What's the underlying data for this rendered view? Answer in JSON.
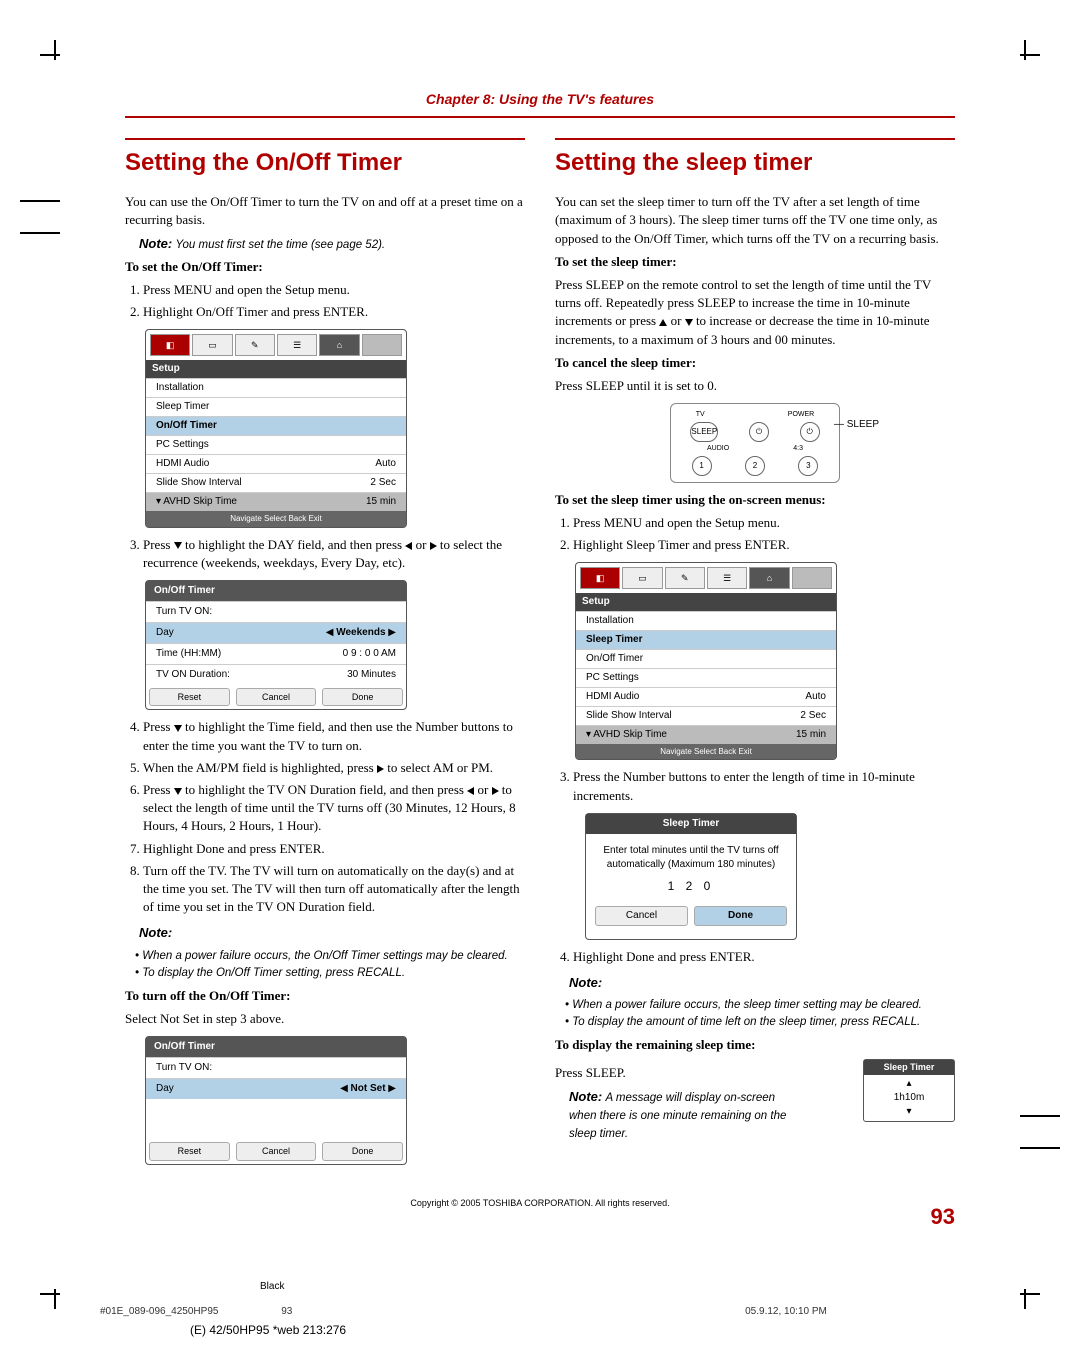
{
  "chapter": "Chapter 8: Using the TV's features",
  "left": {
    "title": "Setting the On/Off Timer",
    "intro": "You can use the On/Off Timer to turn the TV on and off at a preset time on a recurring basis.",
    "note1": "You must first set the time (see page 52).",
    "heading1": "To set the On/Off Timer:",
    "step1": "Press MENU and open the Setup menu.",
    "step2": "Highlight On/Off Timer and press ENTER.",
    "step3a": "Press ",
    "step3b": " to highlight the DAY field, and then press ",
    "step3c": " or ",
    "step3d": " to select the recurrence (weekends, weekdays, Every Day, etc).",
    "step4a": "Press ",
    "step4b": " to highlight the Time field, and then use the Number buttons to enter the time you want the TV to turn on.",
    "step5a": "When the AM/PM field is highlighted, press ",
    "step5b": " to select AM or PM.",
    "step6a": "Press ",
    "step6b": " to highlight the TV ON Duration field, and then press ",
    "step6c": " or ",
    "step6d": " to select the length of time until the TV turns off (30 Minutes, 12 Hours, 8 Hours, 4 Hours, 2 Hours, 1 Hour).",
    "step7": "Highlight Done and press ENTER.",
    "step8": "Turn off the TV. The TV will turn on automatically on the day(s) and at the time you set. The TV will then turn off automatically after the length of time you set in the TV ON Duration field.",
    "note2a": "When a power failure occurs, the On/Off Timer settings may be cleared.",
    "note2b": "To display the On/Off Timer setting, press RECALL.",
    "heading2": "To turn off the On/Off Timer:",
    "off_text": "Select Not Set in step 3 above."
  },
  "right": {
    "title": "Setting the sleep timer",
    "intro": "You can set the sleep timer to turn off the TV after a set length of time (maximum of 3 hours). The sleep timer turns off the TV one time only, as opposed to the On/Off Timer, which turns off the TV on a recurring basis.",
    "heading1": "To set the sleep timer:",
    "para1a": "Press SLEEP on the remote control to set the length of time until the TV turns off. Repeatedly press SLEEP to increase the time in 10-minute increments or press ",
    "para1b": " or ",
    "para1c": " to increase or decrease the time in 10-minute increments, to a maximum of 3 hours and 00 minutes.",
    "heading2": "To cancel the sleep timer:",
    "para2": "Press SLEEP until it is set to 0.",
    "heading3": "To set the sleep timer using the on-screen menus:",
    "step1": "Press MENU and open the Setup menu.",
    "step2": "Highlight Sleep Timer and press ENTER.",
    "step3": "Press the Number buttons to enter the length of time in 10-minute increments.",
    "step4": "Highlight Done and press ENTER.",
    "note_a": "When a power failure occurs, the sleep timer setting may be cleared.",
    "note_b": "To display the amount of time left on the sleep timer, press RECALL.",
    "heading4": "To display the remaining sleep time:",
    "press": "Press SLEEP.",
    "note_display": "A message will display on-screen when there is one minute remaining on the sleep timer."
  },
  "ui": {
    "setup_label": "Setup",
    "installation": "Installation",
    "sleep_timer": "Sleep Timer",
    "onoff_timer": "On/Off Timer",
    "pc_settings": "PC Settings",
    "hdmi_audio": "HDMI Audio",
    "hdmi_audio_val": "Auto",
    "slideshow": "Slide Show Interval",
    "slideshow_val": "2 Sec",
    "avhd": "AVHD Skip Time",
    "avhd_val": "15 min",
    "nav_footer": "Navigate   Select   Back   Exit",
    "timer_title": "On/Off Timer",
    "turn_tv_on": "Turn TV ON:",
    "day": "Day",
    "weekends": "Weekends",
    "time_label": "Time (HH:MM)",
    "time_val": "0 9 : 0 0   AM",
    "duration": "TV ON Duration:",
    "duration_val": "30 Minutes",
    "reset": "Reset",
    "cancel": "Cancel",
    "done": "Done",
    "notset": "Not Set",
    "sleep_title": "Sleep Timer",
    "sleep_msg": "Enter total minutes until the TV turns off automatically (Maximum 180 minutes)",
    "sleep_val": "1 2 0",
    "mini_val": "1h10m",
    "remote_sleep": "SLEEP",
    "remote_power": "POWER"
  },
  "note_label": "Note:",
  "copyright": "Copyright © 2005 TOSHIBA CORPORATION. All rights reserved.",
  "pagenum": "93",
  "footer_left": "#01E_089-096_4250HP95",
  "footer_mid": "93",
  "footer_right": "05.9.12, 10:10 PM",
  "footer_black": "Black",
  "footer_web": "(E) 42/50HP95 *web 213:276"
}
